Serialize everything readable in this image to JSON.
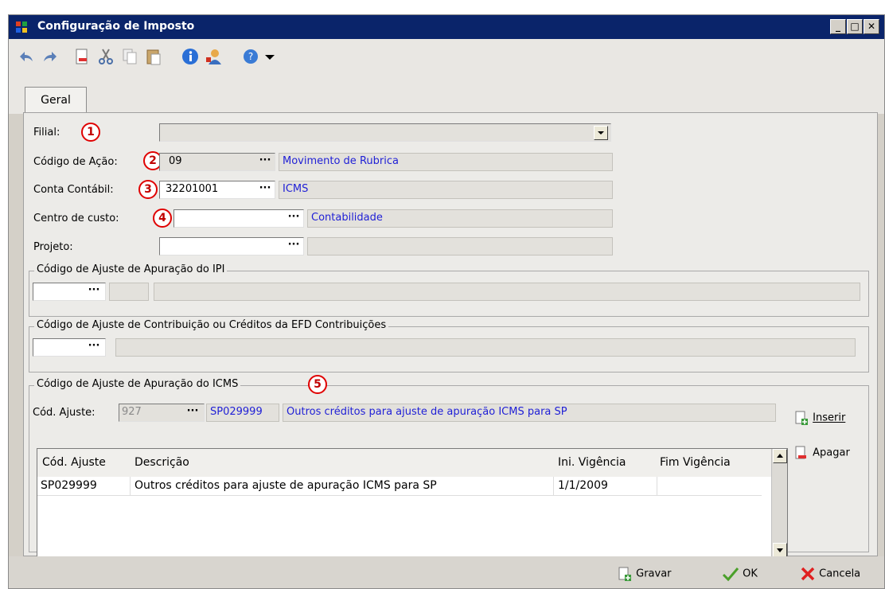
{
  "window": {
    "title": "Configuração de Imposto"
  },
  "toolbar": {
    "icons": [
      "undo-icon",
      "redo-icon",
      "new-doc-icon",
      "cut-icon",
      "copy-icon",
      "paste-icon",
      "info-icon",
      "user-icon",
      "help-icon",
      "dropdown-arrow-icon"
    ]
  },
  "tabs": [
    {
      "label": "Geral"
    }
  ],
  "form": {
    "filial": {
      "label": "Filial:",
      "marker": "1",
      "value": ""
    },
    "codigo_acao": {
      "label": "Código de Ação:",
      "marker": "2",
      "value": "09",
      "description": "Movimento de Rubrica"
    },
    "conta_contabil": {
      "label": "Conta Contábil:",
      "marker": "3",
      "value": "32201001",
      "description": "ICMS"
    },
    "centro_custo": {
      "label": "Centro de custo:",
      "marker": "4",
      "value": "",
      "description": "Contabilidade"
    },
    "projeto": {
      "label": "Projeto:",
      "value": "",
      "description": ""
    },
    "lookup_button": "···"
  },
  "groups": {
    "ipi": {
      "legend": "Código de Ajuste de Apuração do IPI"
    },
    "efd": {
      "legend": "Código de Ajuste de Contribuição ou Créditos da EFD Contribuições"
    },
    "icms": {
      "legend": "Código de Ajuste de Apuração do ICMS",
      "marker": "5",
      "cod_label": "Cód. Ajuste:",
      "cod_value": "927",
      "code_display": "SP029999",
      "desc_display": "Outros créditos para ajuste de apuração ICMS para SP",
      "insert_label": "Inserir",
      "delete_label": "Apagar",
      "columns": [
        "Cód. Ajuste",
        "Descrição",
        "Ini. Vigência",
        "Fim Vigência"
      ],
      "rows": [
        [
          "SP029999",
          "Outros créditos para ajuste de apuração ICMS para SP",
          "1/1/2009",
          ""
        ]
      ]
    }
  },
  "footer": {
    "save": "Gravar",
    "ok": "OK",
    "cancel": "Cancela"
  }
}
